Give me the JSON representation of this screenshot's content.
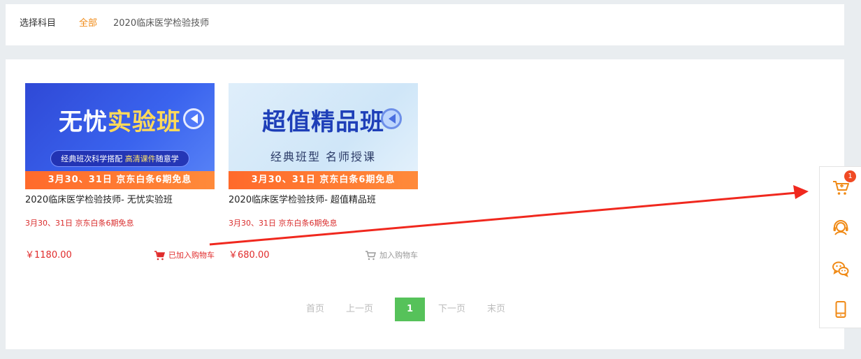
{
  "filter": {
    "label": "选择科目",
    "all": "全部",
    "subject": "2020临床医学检验技师"
  },
  "courses": [
    {
      "banner_title_a": "无忧",
      "banner_title_b": "实验班",
      "banner_sub_a": "经典班次科学搭配 ",
      "banner_sub_b": "高清课件",
      "banner_sub_c": "随意学",
      "banner_strip": "3月30、31日  京东白条6期免息",
      "title": "2020临床医学检验技师- 无忧实验班",
      "promo": "3月30、31日 京东白条6期免息",
      "price": "￥1180.00",
      "cart_label": "已加入购物车",
      "cart_added": true
    },
    {
      "banner_title_a": "超值",
      "banner_title_b": "精品班",
      "banner_sub": "经典班型 名师授课",
      "banner_strip": "3月30、31日  京东白条6期免息",
      "title": "2020临床医学检验技师- 超值精品班",
      "promo": "3月30、31日 京东白条6期免息",
      "price": "￥680.00",
      "cart_label": "加入购物车",
      "cart_added": false
    }
  ],
  "pagination": {
    "first": "首页",
    "prev": "上一页",
    "current": "1",
    "next": "下一页",
    "last": "末页"
  },
  "sidebar": {
    "cart_badge": "1",
    "icons": [
      "cart-icon",
      "customer-service-icon",
      "wechat-icon",
      "mobile-icon"
    ]
  },
  "colors": {
    "accent_orange": "#f08a16",
    "price_red": "#e02b2b",
    "pager_green": "#56c25a",
    "annotation_arrow": "#f0281e"
  }
}
